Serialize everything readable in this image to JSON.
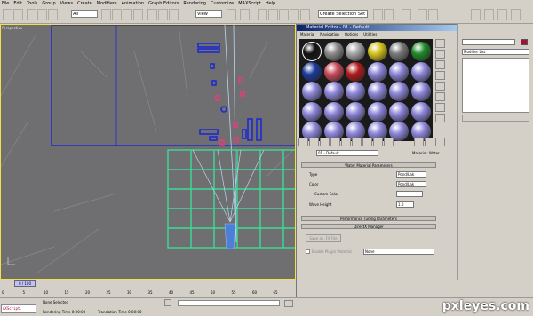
{
  "menu": [
    "File",
    "Edit",
    "Tools",
    "Group",
    "Views",
    "Create",
    "Modifiers",
    "Animation",
    "Graph Editors",
    "Rendering",
    "Customize",
    "MAXScript",
    "Help"
  ],
  "toolbar": {
    "filter": "All",
    "view": "View",
    "selection_set": "Create Selection Set"
  },
  "viewport": {
    "label": "Perspective"
  },
  "right_panel": {
    "modifier_list": "Modifier List"
  },
  "material_editor": {
    "title": "Material Editor - 01 - Default",
    "menu": [
      "Material",
      "Navigation",
      "Options",
      "Utilities"
    ],
    "material_name": "01 - Default",
    "material_type": "Material: Water",
    "rollout_params": "Water Material Parameters",
    "type_label": "Type",
    "type_value": "Pond/Lak",
    "color_label": "Color",
    "color_value": "Pond/Lak",
    "custom_color_label": "Custom Color",
    "wave_height_label": "Wave Height",
    "wave_height_value": "1.0",
    "rollout_perf": "Performance Tuning Parameters",
    "rollout_dx": "DirectX Manager",
    "save_fx": "Save as .FX File",
    "enable_plugin": "Enable Plugin Material",
    "plugin_value": "None"
  },
  "timeline": {
    "frame": "0 / 100",
    "ticks": [
      "0",
      "5",
      "10",
      "15",
      "20",
      "25",
      "30",
      "35",
      "40",
      "45",
      "50",
      "55",
      "60",
      "65"
    ]
  },
  "status": {
    "selected": "None Selected",
    "rendering": "Rendering Time  0:00:00",
    "translation": "Translation Time  0:00:00",
    "script": "AXScript."
  },
  "watermark": "pxleyes.com",
  "colors": {
    "viewport": "#6f6f71",
    "grid": "#3ddc97",
    "blue": "#1f2bd0",
    "pink": "#e0407a"
  }
}
